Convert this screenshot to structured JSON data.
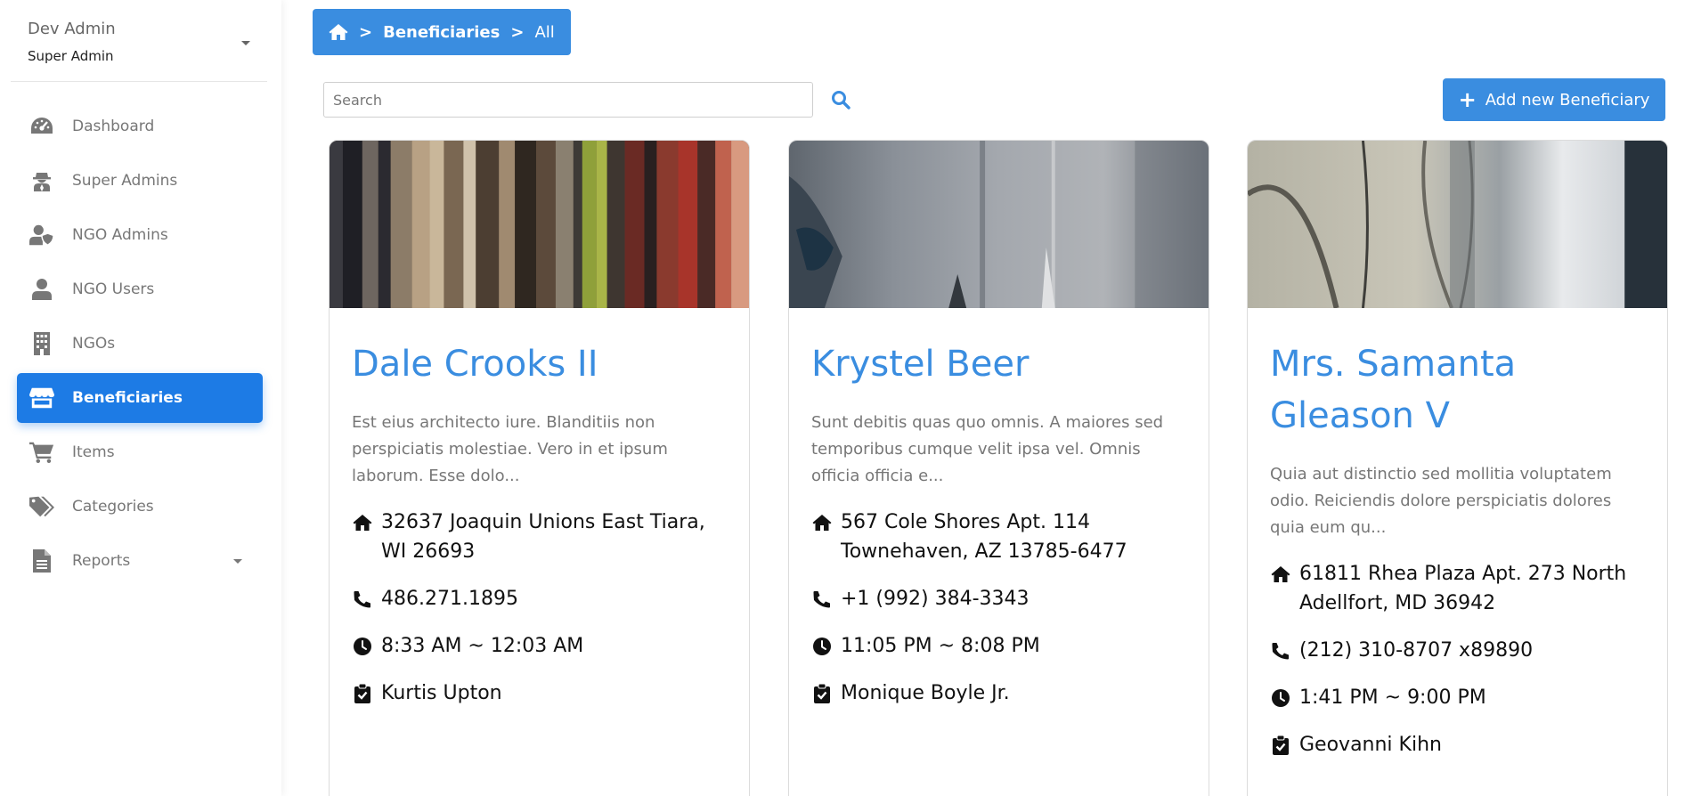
{
  "user": {
    "name": "Dev Admin",
    "role": "Super Admin"
  },
  "nav": {
    "items": [
      {
        "label": "Dashboard",
        "icon": "dashboard-icon"
      },
      {
        "label": "Super Admins",
        "icon": "user-secret-icon"
      },
      {
        "label": "NGO Admins",
        "icon": "user-shield-icon"
      },
      {
        "label": "NGO Users",
        "icon": "user-icon"
      },
      {
        "label": "NGOs",
        "icon": "building-icon"
      },
      {
        "label": "Beneficiaries",
        "icon": "store-icon",
        "active": true
      },
      {
        "label": "Items",
        "icon": "cart-icon"
      },
      {
        "label": "Categories",
        "icon": "tags-icon"
      },
      {
        "label": "Reports",
        "icon": "file-icon"
      }
    ]
  },
  "breadcrumb": {
    "home_icon": "home-icon",
    "section": "Beneficiaries",
    "current": "All",
    "separator": ">"
  },
  "search": {
    "placeholder": "Search",
    "value": ""
  },
  "add_button": {
    "label": "Add new Beneficiary"
  },
  "cards": [
    {
      "name": "Dale Crooks II",
      "description": "Est eius architecto iure. Blanditiis non perspiciatis molestiae. Vero in et ipsum laborum. Esse dolo...",
      "address": "32637 Joaquin Unions East Tiara, WI 26693",
      "phone": "486.271.1895",
      "hours": "8:33 AM ~ 12:03 AM",
      "contact": "Kurtis Upton"
    },
    {
      "name": "Krystel Beer",
      "description": "Sunt debitis quas quo omnis. A maiores sed temporibus cumque velit ipsa vel. Omnis officia officia e...",
      "address": "567 Cole Shores Apt. 114 Townehaven, AZ 13785-6477",
      "phone": "+1 (992) 384-3343",
      "hours": "11:05 PM ~ 8:08 PM",
      "contact": "Monique Boyle Jr."
    },
    {
      "name": "Mrs. Samanta Gleason V",
      "description": "Quia aut distinctio sed mollitia voluptatem odio. Reiciendis dolore perspiciatis dolores quia eum qu...",
      "address": "61811 Rhea Plaza Apt. 273 North Adellfort, MD 36942",
      "phone": "(212) 310-8707 x89890",
      "hours": "1:41 PM ~ 9:00 PM",
      "contact": "Geovanni Kihn"
    }
  ],
  "colors": {
    "accent": "#3a8de0",
    "nav_active": "#1d7be5",
    "muted_text": "#777777"
  }
}
